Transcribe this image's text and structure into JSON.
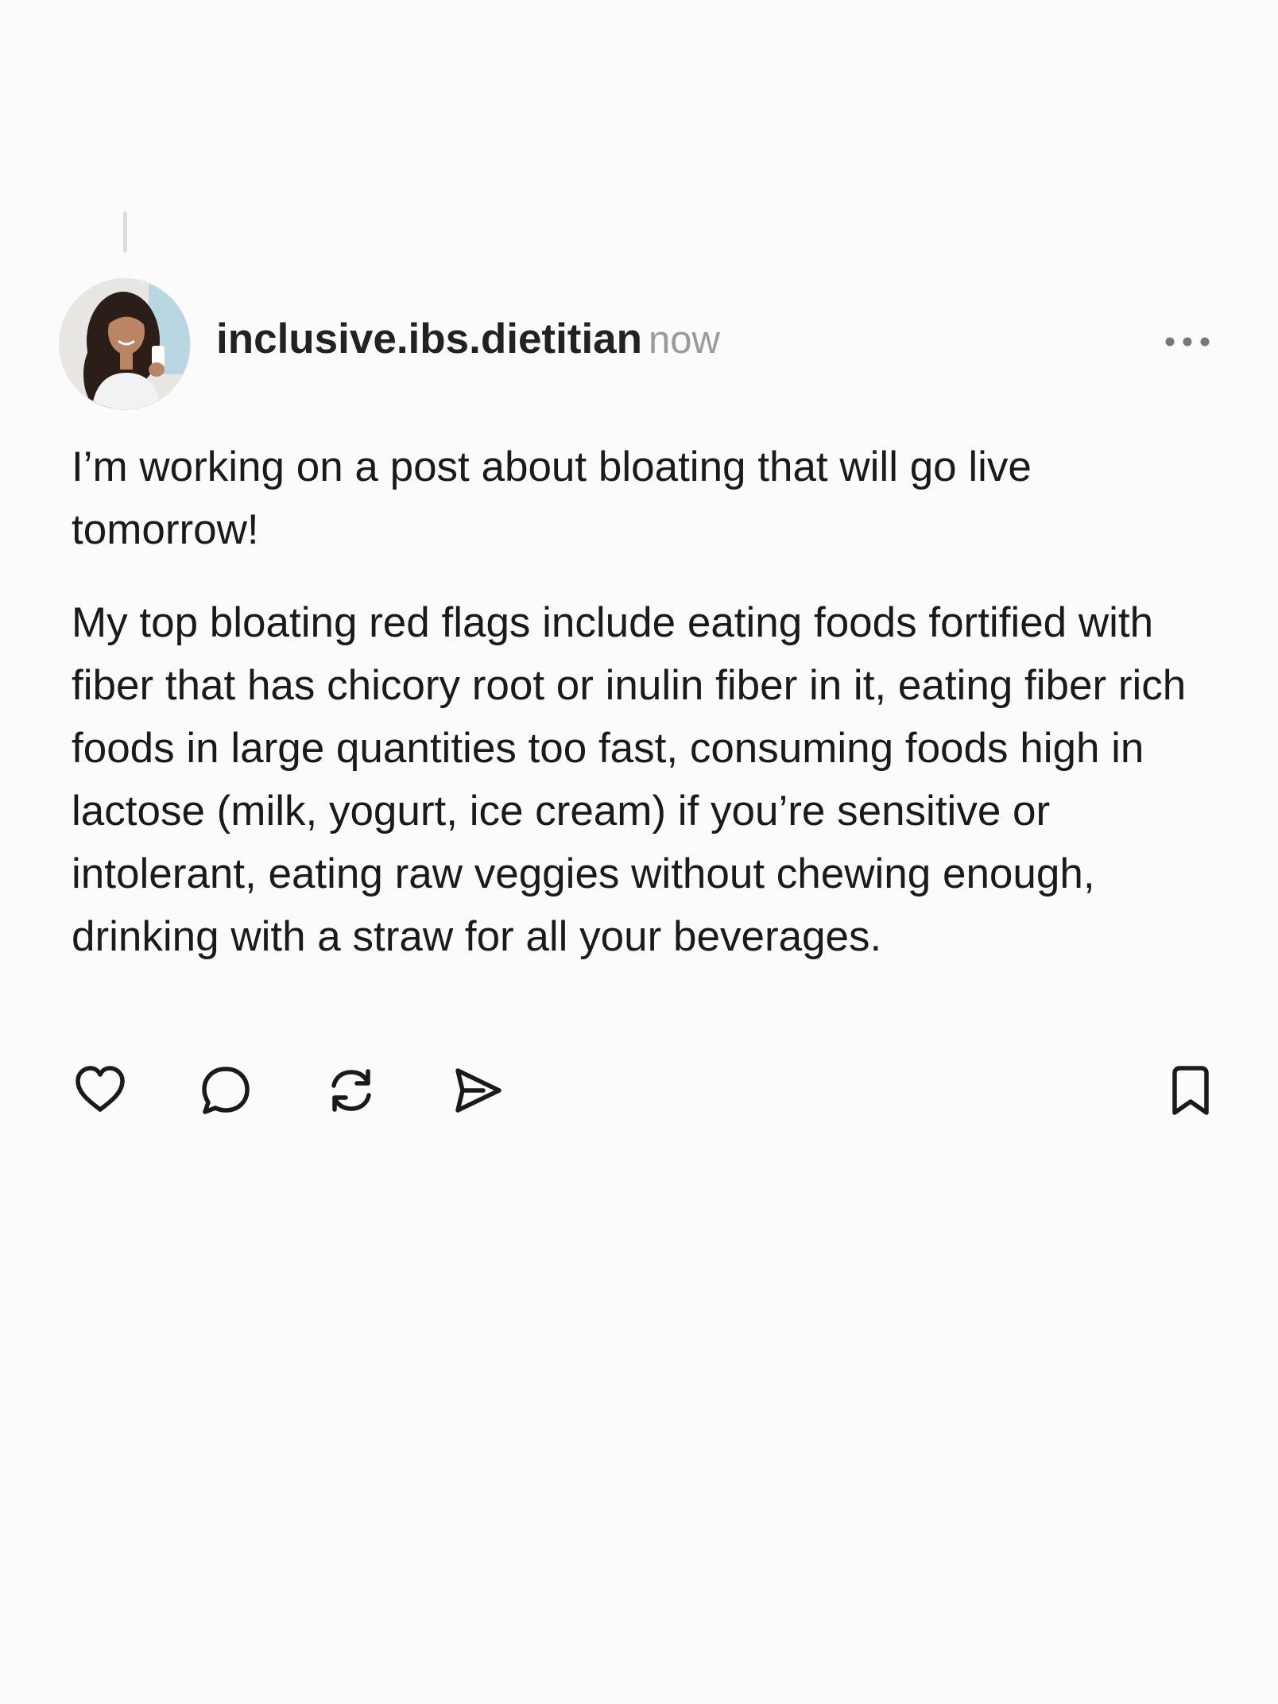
{
  "post": {
    "username": "inclusive.ibs.dietitian",
    "timestamp": "now",
    "paragraphs": [
      "I’m working on a post about bloating that will go live tomorrow!",
      "My top bloating red flags include eating foods fortified with fiber that has chicory root or inulin fiber in it, eating fiber rich foods in large quantities too fast, consuming foods high in lactose (milk, yogurt, ice cream) if you’re sensitive or intolerant, eating raw veggies without chewing enough, drinking with a straw for all your beverages."
    ]
  },
  "icons": {
    "more": "more-horizontal-icon",
    "like": "heart-icon",
    "comment": "comment-bubble-icon",
    "repost": "repost-icon",
    "share": "send-icon",
    "save": "bookmark-icon"
  },
  "colors": {
    "background": "#fbfbfc",
    "text": "#1a1a1a",
    "muted": "#9a9a9a",
    "thread_line": "#dcdcdc"
  }
}
